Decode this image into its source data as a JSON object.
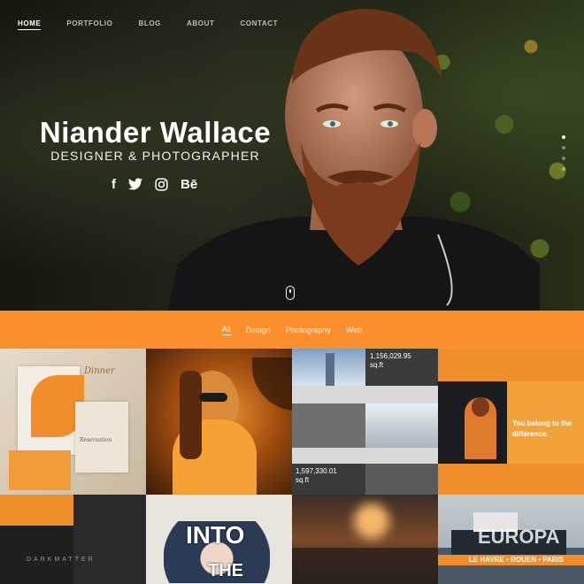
{
  "nav": {
    "items": [
      {
        "label": "HOME",
        "active": true
      },
      {
        "label": "PORTFOLIO"
      },
      {
        "label": "BLOG"
      },
      {
        "label": "ABOUT"
      },
      {
        "label": "CONTACT"
      }
    ]
  },
  "hero": {
    "name": "Niander Wallace",
    "subtitle": "DESIGNER & PHOTOGRAPHER",
    "social": [
      {
        "icon": "facebook-icon",
        "glyph": "f"
      },
      {
        "icon": "twitter-icon",
        "glyph": "🐦"
      },
      {
        "icon": "instagram-icon",
        "glyph": "◎"
      },
      {
        "icon": "behance-icon",
        "glyph": "Bē"
      }
    ],
    "slide_dots": 4,
    "active_slide": 1
  },
  "filters": {
    "items": [
      {
        "label": "All",
        "active": true
      },
      {
        "label": "Design"
      },
      {
        "label": "Photography"
      },
      {
        "label": "Web"
      }
    ]
  },
  "portfolio": {
    "tiles": [
      {
        "name": "tile-stationery",
        "texts": [
          "Dinner",
          "Reservation"
        ]
      },
      {
        "name": "tile-portrait-woman",
        "texts": []
      },
      {
        "name": "tile-real-estate-web",
        "texts": [
          "1,156,029.95",
          "sq.ft",
          "1,597,330.01",
          "sq.ft"
        ]
      },
      {
        "name": "tile-web-orange",
        "texts": [
          "You belong to the",
          "difference."
        ]
      },
      {
        "name": "tile-darkmatter",
        "texts": [
          "DARKMATTER"
        ]
      },
      {
        "name": "tile-into-the",
        "texts": [
          "INTO",
          "THE"
        ]
      },
      {
        "name": "tile-city-street",
        "texts": []
      },
      {
        "name": "tile-europa-ship",
        "texts": [
          "EUROPA",
          "LE HAVRE • ROUEN • PARIS"
        ]
      }
    ]
  },
  "colors": {
    "accent": "#fb8f2d",
    "white": "#ffffff"
  }
}
